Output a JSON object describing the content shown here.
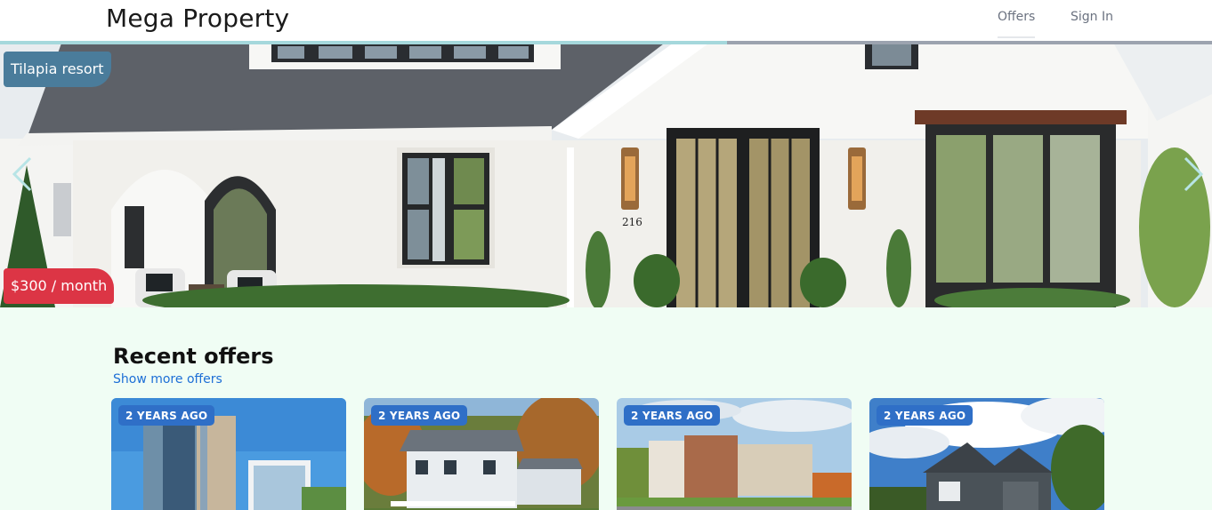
{
  "header": {
    "brand": "Mega Property",
    "nav": [
      {
        "label": "Offers",
        "active": true
      },
      {
        "label": "Sign In",
        "active": false
      }
    ]
  },
  "hero": {
    "property_name": "Tilapia resort",
    "price": "$300 / month",
    "house_number": "216",
    "slide_progress": 0.6,
    "colors": {
      "name_badge": "#4a7c9b",
      "price_badge": "#dc3545",
      "progress": "#a5d8dc"
    },
    "prev_icon": "chevron-left-icon",
    "next_icon": "chevron-right-icon"
  },
  "recent": {
    "title": "Recent offers",
    "show_more": "Show more offers",
    "cards": [
      {
        "time": "2 YEARS AGO"
      },
      {
        "time": "2 YEARS AGO"
      },
      {
        "time": "2 YEARS AGO"
      },
      {
        "time": "2 YEARS AGO"
      }
    ]
  }
}
